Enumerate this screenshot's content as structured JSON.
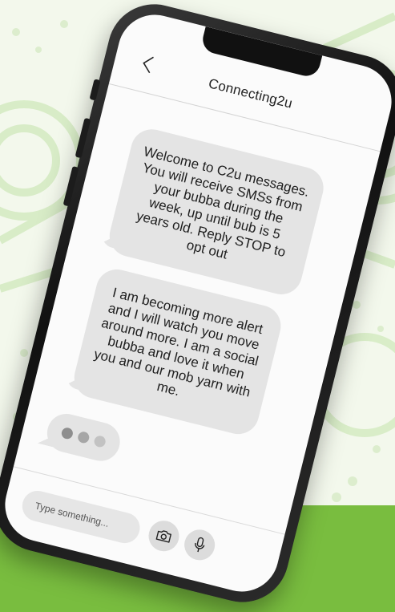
{
  "app": {
    "title": "Connecting2u"
  },
  "messages": [
    {
      "text": "Welcome to C2u messages. You will receive SMSs from your bubba during the week, up until bub is 5 years old. Reply STOP to opt out"
    },
    {
      "text": "I am becoming more alert and I will watch you move around more. I am a social bubba and love it when you and our mob yarn with me."
    }
  ],
  "composer": {
    "placeholder": "Type something..."
  },
  "icons": {
    "back": "chevron-left-icon",
    "camera": "camera-icon",
    "mic": "microphone-icon"
  },
  "colors": {
    "accent_green": "#79bd3f",
    "bubble_gray": "#e4e4e4",
    "background": "#f3f8ec"
  }
}
